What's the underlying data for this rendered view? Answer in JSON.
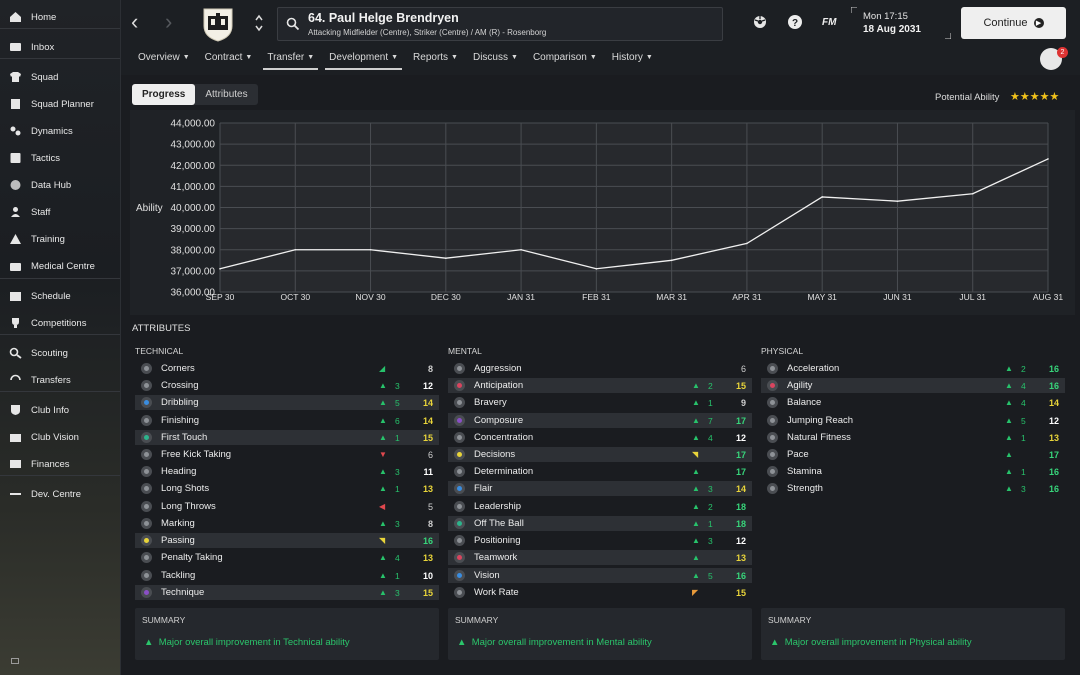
{
  "sidebar": {
    "items": [
      {
        "label": "Home",
        "icon": "home-icon"
      },
      {
        "label": "Inbox",
        "icon": "inbox-icon"
      },
      {
        "label": "Squad",
        "icon": "shirt-icon"
      },
      {
        "label": "Squad Planner",
        "icon": "planner-icon"
      },
      {
        "label": "Dynamics",
        "icon": "dynamics-icon"
      },
      {
        "label": "Tactics",
        "icon": "tactics-icon"
      },
      {
        "label": "Data Hub",
        "icon": "data-hub-icon"
      },
      {
        "label": "Staff",
        "icon": "staff-icon"
      },
      {
        "label": "Training",
        "icon": "training-icon"
      },
      {
        "label": "Medical Centre",
        "icon": "medical-icon"
      },
      {
        "label": "Schedule",
        "icon": "calendar-icon"
      },
      {
        "label": "Competitions",
        "icon": "trophy-icon"
      },
      {
        "label": "Scouting",
        "icon": "scouting-icon"
      },
      {
        "label": "Transfers",
        "icon": "transfers-icon"
      },
      {
        "label": "Club Info",
        "icon": "club-info-icon"
      },
      {
        "label": "Club Vision",
        "icon": "club-vision-icon"
      },
      {
        "label": "Finances",
        "icon": "finances-icon"
      },
      {
        "label": "Dev. Centre",
        "icon": "dev-centre-icon"
      }
    ]
  },
  "header": {
    "player_name": "64. Paul Helge Brendryen",
    "player_positions": "Attacking Midfielder (Centre), Striker (Centre) / AM (R) - Rosenborg",
    "time": "Mon 17:15",
    "date": "18 Aug 2031",
    "fm_label": "FM",
    "continue_label": "Continue",
    "notification_count": "2"
  },
  "tabs": [
    {
      "label": "Overview",
      "active": false
    },
    {
      "label": "Contract",
      "active": false
    },
    {
      "label": "Transfer",
      "active": true
    },
    {
      "label": "Development",
      "active": true
    },
    {
      "label": "Reports",
      "active": false
    },
    {
      "label": "Discuss",
      "active": false
    },
    {
      "label": "Comparison",
      "active": false
    },
    {
      "label": "History",
      "active": false
    }
  ],
  "subtabs": {
    "progress": "Progress",
    "attributes": "Attributes"
  },
  "potential": {
    "label": "Potential Ability",
    "stars": "★★★★★"
  },
  "chart_data": {
    "type": "line",
    "ylabel": "Ability",
    "ylim": [
      36000,
      44000
    ],
    "yticks": [
      "36,000.00",
      "37,000.00",
      "38,000.00",
      "39,000.00",
      "40,000.00",
      "41,000.00",
      "42,000.00",
      "43,000.00",
      "44,000.00"
    ],
    "categories": [
      "SEP 30",
      "OCT 30",
      "NOV 30",
      "DEC 30",
      "JAN 31",
      "FEB 31",
      "MAR 31",
      "APR 31",
      "MAY 31",
      "JUN 31",
      "JUL 31",
      "AUG 31"
    ],
    "values": [
      37100,
      38000,
      38000,
      37600,
      38000,
      37100,
      37500,
      38300,
      40500,
      40300,
      40650,
      42300
    ],
    "grid": true,
    "color": "#f0f0f0"
  },
  "attributes_title": "ATTRIBUTES",
  "technical": {
    "heading": "TECHNICAL",
    "rows": [
      {
        "name": "Corners",
        "change": "",
        "value": "8",
        "trend": "flat-up",
        "hl": false
      },
      {
        "name": "Crossing",
        "change": "3",
        "value": "12",
        "trend": "up",
        "hl": false
      },
      {
        "name": "Dribbling",
        "change": "5",
        "value": "14",
        "trend": "up",
        "hl": true
      },
      {
        "name": "Finishing",
        "change": "6",
        "value": "14",
        "trend": "up",
        "hl": false
      },
      {
        "name": "First Touch",
        "change": "1",
        "value": "15",
        "trend": "up",
        "hl": true
      },
      {
        "name": "Free Kick Taking",
        "change": "",
        "value": "6",
        "trend": "down",
        "hl": false
      },
      {
        "name": "Heading",
        "change": "3",
        "value": "11",
        "trend": "up",
        "hl": false
      },
      {
        "name": "Long Shots",
        "change": "1",
        "value": "13",
        "trend": "up",
        "hl": false
      },
      {
        "name": "Long Throws",
        "change": "",
        "value": "5",
        "trend": "flat-down",
        "hl": false
      },
      {
        "name": "Marking",
        "change": "3",
        "value": "8",
        "trend": "up",
        "hl": false
      },
      {
        "name": "Passing",
        "change": "",
        "value": "16",
        "trend": "flat-yellow",
        "hl": true
      },
      {
        "name": "Penalty Taking",
        "change": "4",
        "value": "13",
        "trend": "up",
        "hl": false
      },
      {
        "name": "Tackling",
        "change": "1",
        "value": "10",
        "trend": "up",
        "hl": false
      },
      {
        "name": "Technique",
        "change": "3",
        "value": "15",
        "trend": "up",
        "hl": true
      }
    ]
  },
  "mental": {
    "heading": "MENTAL",
    "rows": [
      {
        "name": "Aggression",
        "change": "",
        "value": "6",
        "trend": "none",
        "hl": false
      },
      {
        "name": "Anticipation",
        "change": "2",
        "value": "15",
        "trend": "up",
        "hl": true
      },
      {
        "name": "Bravery",
        "change": "1",
        "value": "9",
        "trend": "up",
        "hl": false
      },
      {
        "name": "Composure",
        "change": "7",
        "value": "17",
        "trend": "up",
        "hl": true
      },
      {
        "name": "Concentration",
        "change": "4",
        "value": "12",
        "trend": "up",
        "hl": false
      },
      {
        "name": "Decisions",
        "change": "",
        "value": "17",
        "trend": "flat-yellow",
        "hl": true
      },
      {
        "name": "Determination",
        "change": "",
        "value": "17",
        "trend": "up",
        "hl": false
      },
      {
        "name": "Flair",
        "change": "3",
        "value": "14",
        "trend": "up",
        "hl": true
      },
      {
        "name": "Leadership",
        "change": "2",
        "value": "18",
        "trend": "up",
        "hl": false
      },
      {
        "name": "Off The Ball",
        "change": "1",
        "value": "18",
        "trend": "up",
        "hl": true
      },
      {
        "name": "Positioning",
        "change": "3",
        "value": "12",
        "trend": "up",
        "hl": false
      },
      {
        "name": "Teamwork",
        "change": "",
        "value": "13",
        "trend": "up",
        "hl": true
      },
      {
        "name": "Vision",
        "change": "5",
        "value": "16",
        "trend": "up",
        "hl": true
      },
      {
        "name": "Work Rate",
        "change": "",
        "value": "15",
        "trend": "flat-orange",
        "hl": false
      }
    ]
  },
  "physical": {
    "heading": "PHYSICAL",
    "rows": [
      {
        "name": "Acceleration",
        "change": "2",
        "value": "16",
        "trend": "up",
        "hl": false
      },
      {
        "name": "Agility",
        "change": "4",
        "value": "16",
        "trend": "up",
        "hl": true
      },
      {
        "name": "Balance",
        "change": "4",
        "value": "14",
        "trend": "up",
        "hl": false
      },
      {
        "name": "Jumping Reach",
        "change": "5",
        "value": "12",
        "trend": "up",
        "hl": false
      },
      {
        "name": "Natural Fitness",
        "change": "1",
        "value": "13",
        "trend": "up",
        "hl": false
      },
      {
        "name": "Pace",
        "change": "",
        "value": "17",
        "trend": "up",
        "hl": false
      },
      {
        "name": "Stamina",
        "change": "1",
        "value": "16",
        "trend": "up",
        "hl": false
      },
      {
        "name": "Strength",
        "change": "3",
        "value": "16",
        "trend": "up",
        "hl": false
      }
    ]
  },
  "summaries": [
    {
      "title": "SUMMARY",
      "text": "Major overall improvement in Technical ability"
    },
    {
      "title": "SUMMARY",
      "text": "Major overall improvement in Mental ability"
    },
    {
      "title": "SUMMARY",
      "text": "Major overall improvement in Physical ability"
    }
  ],
  "colors": {
    "up": "#27c26b",
    "down": "#e0484e",
    "yellow": "#e8d43a",
    "orange": "#e89a3a",
    "star": "#f1c21b"
  }
}
